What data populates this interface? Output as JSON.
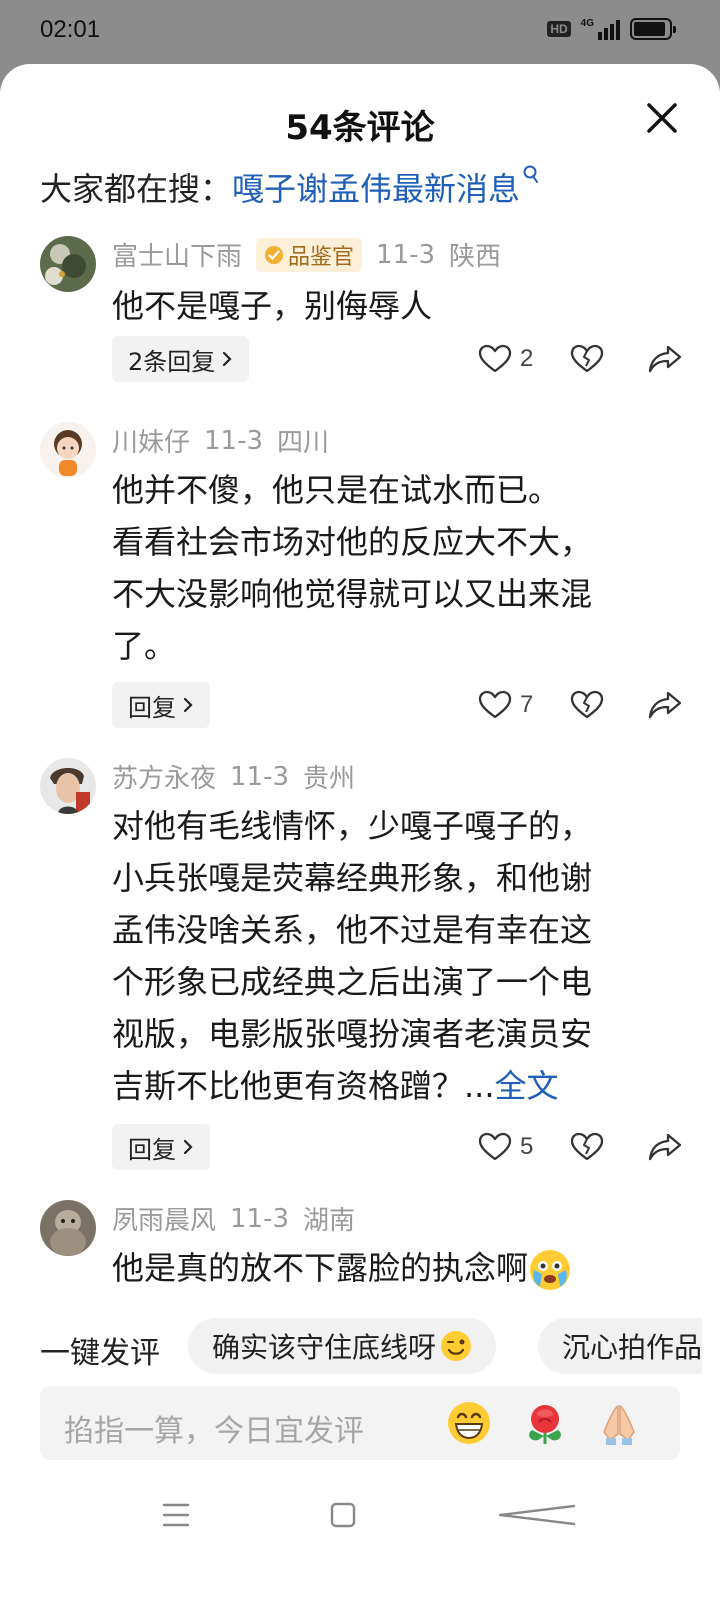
{
  "status_bar": {
    "time": "02:01",
    "hd": "HD",
    "network": "4G",
    "battery_level": 0.9
  },
  "sheet": {
    "title": "54条评论"
  },
  "trending": {
    "prefix": "大家都在搜：",
    "keyword": "嘎子谢孟伟最新消息"
  },
  "comments": [
    {
      "user": "富士山下雨",
      "badge": "品鉴官",
      "date": "11-3",
      "location": "陕西",
      "lines": [
        "他不是嘎子，别侮辱人"
      ],
      "reply_label": "2条回复",
      "likes": "2"
    },
    {
      "user": "川妹仔",
      "date": "11-3",
      "location": "四川",
      "lines": [
        "他并不傻，他只是在试水而已。",
        "看看社会市场对他的反应大不大，",
        "不大没影响他觉得就可以又出来混",
        "了。"
      ],
      "reply_label": "回复",
      "likes": "7"
    },
    {
      "user": "苏方永夜",
      "date": "11-3",
      "location": "贵州",
      "lines": [
        "对他有毛线情怀，少嘎子嘎子的，",
        "小兵张嘎是荧幕经典形象，和他谢",
        "孟伟没啥关系，他不过是有幸在这",
        "个形象已成经典之后出演了一个电",
        "视版，电影版张嘎扮演者老演员安",
        "吉斯不比他更有资格蹭？..."
      ],
      "more_label": "全文",
      "reply_label": "回复",
      "likes": "5"
    },
    {
      "user": "夙雨晨风",
      "date": "11-3",
      "location": "湖南",
      "lines": [
        "他是真的放不下露脸的执念啊"
      ]
    }
  ],
  "quick_comment": {
    "label": "一键发评",
    "chips": [
      "确实该守住底线呀",
      "沉心拍作品"
    ]
  },
  "input": {
    "placeholder": "掐指一算，今日宜发评"
  },
  "icons": {
    "close": "close-icon",
    "search": "search-icon",
    "like": "heart-icon",
    "dislike": "broken-heart-icon",
    "share": "share-icon",
    "grin": "grin-emoji",
    "rose": "rose-emoji",
    "pray": "pray-emoji"
  },
  "colors": {
    "link": "#1f5fb8",
    "badge_bg": "#fdf0d9",
    "badge_text": "#a36a1c"
  }
}
